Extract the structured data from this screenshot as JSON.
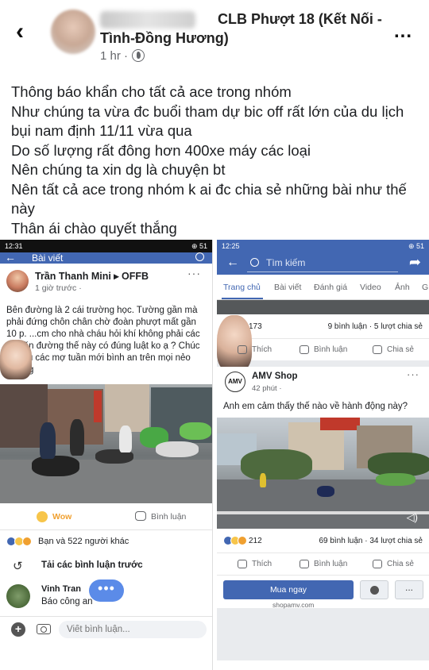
{
  "header": {
    "group_name": "CLB Phượt 18 (Kết Nối -Tình-Đồng Hương)",
    "time": "1 hr ·",
    "more": "..."
  },
  "post": {
    "lines": [
      "Thông báo khẩn cho tất cả ace trong nhóm",
      "Như chúng ta vừa đc buổi tham dự bic off rất lớn của  du lịch bụi nam định 11/11 vừa qua",
      "Do số lượng rất đông hơn 400xe máy các loại",
      "Nên chúng ta xin dg là chuyện bt",
      "Nên tất cả ace trong nhóm k ai đc chia sẻ những bài như thế này",
      "Thân ái chào quyết thắng"
    ]
  },
  "left_screen": {
    "status_time": "12:31",
    "status_right": "⊕ 51",
    "nav_title": "Bài viết",
    "author": "Trần Thanh Mini ▸ OFFB",
    "time": "1 giờ trước ·",
    "text": "Bên đường là 2 cái trường học. Tường gần mà phải đứng chôn chân chờ đoàn phượt mất gần 10 p. ...cm cho nhà cháu hỏi khí không phải các ...chặn đường thế này có đúng luật ko ạ ? Chúc các cụ các mợ tuần mới bình an trên mọi nẻo đường",
    "reaction_label": "Wow",
    "comment_label": "Bình luận",
    "likes_text": "Bạn và 522 người khác",
    "load_more": "Tải các bình luận trước",
    "commenter_name": "Vinh Tran",
    "commenter_text": "Báo công an",
    "input_placeholder": "Viết bình luận..."
  },
  "right_screen": {
    "status_time": "12:25",
    "status_right": "⊕ 51",
    "search_placeholder": "Tìm kiếm",
    "tabs": [
      "Trang chủ",
      "Bài viết",
      "Đánh giá",
      "Video",
      "Ảnh",
      "G"
    ],
    "top_stats": {
      "count": "173",
      "right": "9 bình luận · 5 lượt chia sẻ"
    },
    "actions": {
      "like": "Thích",
      "comment": "Bình luận",
      "share": "Chia sẻ"
    },
    "shop_name": "AMV Shop",
    "shop_time": "42 phút ·",
    "shop_logo": "AMV",
    "shop_text": "Anh em cảm thấy thế nào về hành động này?",
    "bottom_stats": {
      "count": "212",
      "right": "69 bình luận · 34 lượt chia sẻ"
    },
    "buy_label": "Mua ngay",
    "more_label": "...",
    "shop_url": "shopamv.com"
  },
  "colors": {
    "fb_blue": "#4267b2",
    "wow": "#f7c54a"
  }
}
